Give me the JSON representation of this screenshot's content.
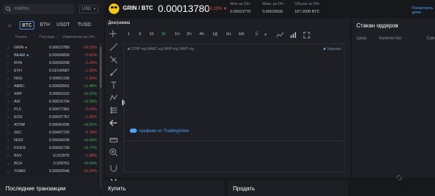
{
  "search": {
    "placeholder": "Найти"
  },
  "quote_currency": "USD",
  "market_tabs": [
    "BTC",
    "ETH",
    "USDT",
    "TUSD"
  ],
  "market_headers": {
    "market": "Рынок",
    "last_price": "Последн",
    "change": "Изменения за 24ч"
  },
  "markets": [
    {
      "symbol": "GRIN",
      "badge": "hot",
      "price": "0.00013780",
      "change": "-10.23%",
      "dir": "neg"
    },
    {
      "symbol": "BEAM",
      "badge": "new",
      "price": "0.00006839",
      "change": "-5.52%",
      "dir": "neg"
    },
    {
      "symbol": "RVN",
      "badge": "",
      "price": "0.00000298",
      "change": "-2.29%",
      "dir": "neg"
    },
    {
      "symbol": "ETH",
      "badge": "",
      "price": "0.02142687",
      "change": "-1.09%",
      "dir": "neg"
    },
    {
      "symbol": "NSG",
      "badge": "",
      "price": "0.00001136",
      "change": "-1.04%",
      "dir": "neg"
    },
    {
      "symbol": "ABBC",
      "badge": "",
      "price": "0.00002591",
      "change": "+1.48%",
      "dir": "pos"
    },
    {
      "symbol": "XRP",
      "badge": "",
      "price": "0.00003110",
      "change": "+0.22%",
      "dir": "pos"
    },
    {
      "symbol": "AIS",
      "badge": "",
      "price": "0.00015734",
      "change": "+0.28%",
      "dir": "pos"
    },
    {
      "symbol": "PLC",
      "badge": "",
      "price": "0.00077361",
      "change": "-2.03%",
      "dir": "neg"
    },
    {
      "symbol": "EOS",
      "badge": "",
      "price": "0.00037757",
      "change": "-1.25%",
      "dir": "neg"
    },
    {
      "symbol": "ATOM",
      "badge": "",
      "price": "0.00041696",
      "change": "+0.81%",
      "dir": "pos"
    },
    {
      "symbol": "ZEC",
      "badge": "",
      "price": "0.00407720",
      "change": "-2.78%",
      "dir": "neg"
    },
    {
      "symbol": "NOIZ",
      "badge": "",
      "price": "0.00004228",
      "change": "+0.04%",
      "dir": "pos"
    },
    {
      "symbol": "KICKS",
      "badge": "",
      "price": "0.00002730",
      "change": "+0.77%",
      "dir": "pos"
    },
    {
      "symbol": "BSV",
      "badge": "",
      "price": "0.012975",
      "change": "-1.38%",
      "dir": "neg"
    },
    {
      "symbol": "BCH",
      "badge": "",
      "price": "0.029761",
      "change": "+0.69%",
      "dir": "pos"
    },
    {
      "symbol": "TOMO",
      "badge": "",
      "price": "0.00002545",
      "change": "-10.29%",
      "dir": "neg"
    }
  ],
  "header": {
    "pair": "GRIN / BTC",
    "price": "0.00013780",
    "change": "-10.23%",
    "change_arrow": "▼",
    "low_label": "Мин за 24ч",
    "low_value": "0.00013770",
    "high_label": "Макс за 24ч",
    "high_value": "0.00015500",
    "volume_label": "Объем за 24ч",
    "volume_value": "167.2000 BTC",
    "demo_link": "Посмотреть демо"
  },
  "chart": {
    "title": "Диаграмма",
    "timeframes": [
      "1",
      "5",
      "15",
      "30",
      "1Ч",
      "2Ч",
      "4Ч",
      "1Д",
      "1Н",
      "1М"
    ],
    "active_timeframe": "30",
    "ohlc_text": "ОТКР н/д  МАКС н/д  МИН н/д  ЗАКР н/д",
    "loading_text": "Загрузка",
    "tv_link": "графики от TradingView"
  },
  "order_book": {
    "title": "Стакан ордеров",
    "col_price": "Цена",
    "col_amount": "Количество",
    "col_sum": "Сум"
  },
  "bottom": {
    "trades": "Последние транзакции",
    "buy": "Купить",
    "sell": "Продать"
  },
  "colors": {
    "up": "#3fb65e",
    "down": "#e0504a",
    "accent": "#4aa3ff",
    "logo": "#f0c419"
  }
}
